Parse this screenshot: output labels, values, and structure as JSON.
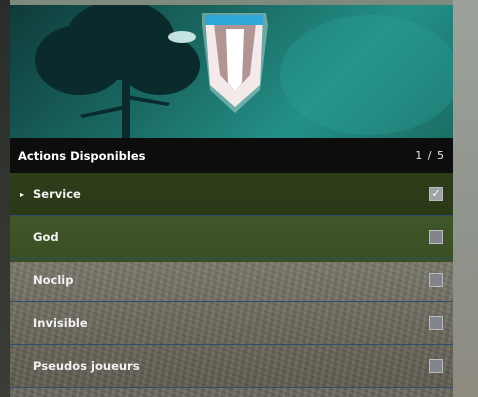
{
  "menu": {
    "title": "Actions Disponibles",
    "counter": "1 / 5",
    "selected_marker": "▸",
    "check_glyph": "✓",
    "items": [
      {
        "label": "Service",
        "checked": true,
        "selected": true
      },
      {
        "label": "God",
        "checked": false,
        "selected": false
      },
      {
        "label": "Noclip",
        "checked": false,
        "selected": false
      },
      {
        "label": "Invisible",
        "checked": false,
        "selected": false
      },
      {
        "label": "Pseudos joueurs",
        "checked": false,
        "selected": false
      }
    ]
  },
  "colors": {
    "banner_teal": "#1a6963",
    "header_bg": "#0d0d0d",
    "row_divider": "#2d4f6b",
    "checkbox": "#82868c"
  }
}
